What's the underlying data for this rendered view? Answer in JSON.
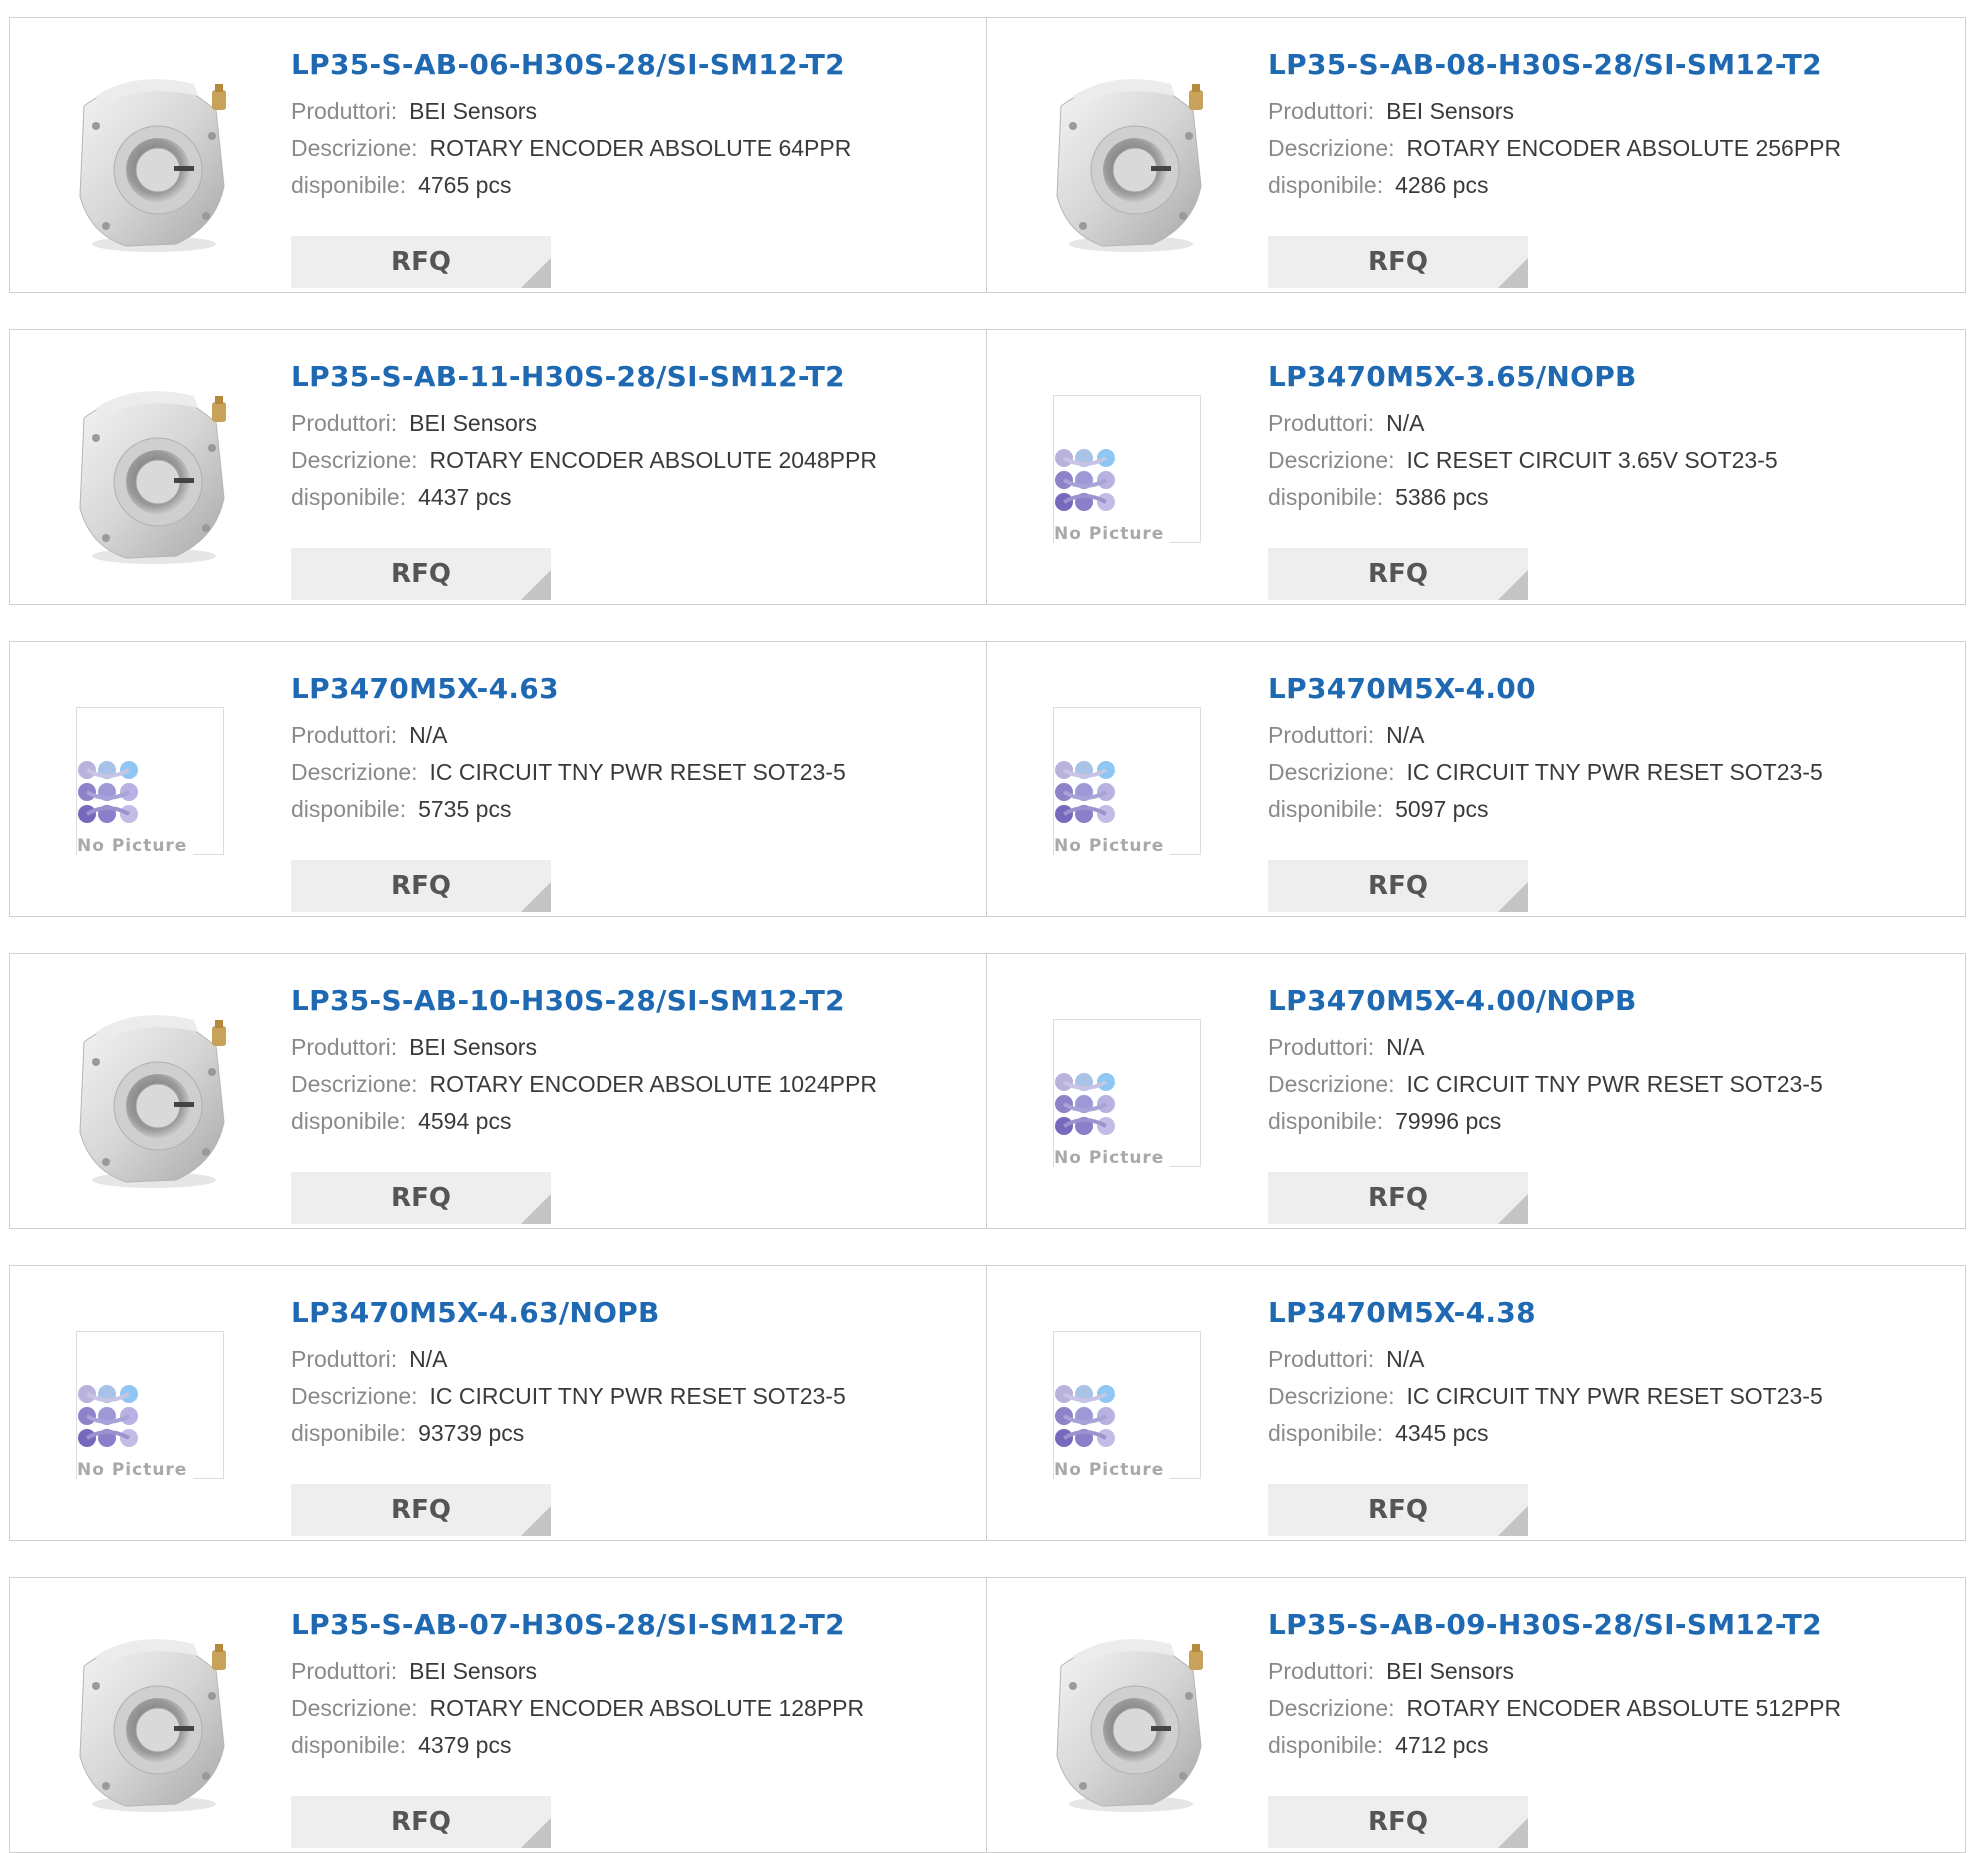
{
  "rfq_label": "RFQ",
  "labels": {
    "manufacturer": "Produttori:",
    "description": "Descrizione:",
    "available": "disponibile:"
  },
  "no_picture_label": "No Picture",
  "products": [
    {
      "part": "LP35-S-AB-06-H30S-28/SI-SM12-T2",
      "manufacturer": "BEI Sensors",
      "description": "ROTARY ENCODER ABSOLUTE 64PPR",
      "available": "4765 pcs",
      "image": "encoder-photo"
    },
    {
      "part": "LP35-S-AB-08-H30S-28/SI-SM12-T2",
      "manufacturer": "BEI Sensors",
      "description": "ROTARY ENCODER ABSOLUTE 256PPR",
      "available": "4286 pcs",
      "image": "encoder-photo"
    },
    {
      "part": "LP35-S-AB-11-H30S-28/SI-SM12-T2",
      "manufacturer": "BEI Sensors",
      "description": "ROTARY ENCODER ABSOLUTE 2048PPR",
      "available": "4437 pcs",
      "image": "encoder-photo"
    },
    {
      "part": "LP3470M5X-3.65/NOPB",
      "manufacturer": "N/A",
      "description": "IC RESET CIRCUIT 3.65V SOT23-5",
      "available": "5386 pcs",
      "image": "no-picture"
    },
    {
      "part": "LP3470M5X-4.63",
      "manufacturer": "N/A",
      "description": "IC CIRCUIT TNY PWR RESET SOT23-5",
      "available": "5735 pcs",
      "image": "no-picture"
    },
    {
      "part": "LP3470M5X-4.00",
      "manufacturer": "N/A",
      "description": "IC CIRCUIT TNY PWR RESET SOT23-5",
      "available": "5097 pcs",
      "image": "no-picture"
    },
    {
      "part": "LP35-S-AB-10-H30S-28/SI-SM12-T2",
      "manufacturer": "BEI Sensors",
      "description": "ROTARY ENCODER ABSOLUTE 1024PPR",
      "available": "4594 pcs",
      "image": "encoder-photo"
    },
    {
      "part": "LP3470M5X-4.00/NOPB",
      "manufacturer": "N/A",
      "description": "IC CIRCUIT TNY PWR RESET SOT23-5",
      "available": "79996 pcs",
      "image": "no-picture"
    },
    {
      "part": "LP3470M5X-4.63/NOPB",
      "manufacturer": "N/A",
      "description": "IC CIRCUIT TNY PWR RESET SOT23-5",
      "available": "93739 pcs",
      "image": "no-picture"
    },
    {
      "part": "LP3470M5X-4.38",
      "manufacturer": "N/A",
      "description": "IC CIRCUIT TNY PWR RESET SOT23-5",
      "available": "4345 pcs",
      "image": "no-picture"
    },
    {
      "part": "LP35-S-AB-07-H30S-28/SI-SM12-T2",
      "manufacturer": "BEI Sensors",
      "description": "ROTARY ENCODER ABSOLUTE 128PPR",
      "available": "4379 pcs",
      "image": "encoder-photo"
    },
    {
      "part": "LP35-S-AB-09-H30S-28/SI-SM12-T2",
      "manufacturer": "BEI Sensors",
      "description": "ROTARY ENCODER ABSOLUTE 512PPR",
      "available": "4712 pcs",
      "image": "encoder-photo"
    }
  ],
  "colors": {
    "title": "#1f69b3",
    "label": "#8a8a8a",
    "value": "#3a3a3a",
    "rfq_bg": "#eeeeee",
    "border": "#cfcfcf"
  }
}
